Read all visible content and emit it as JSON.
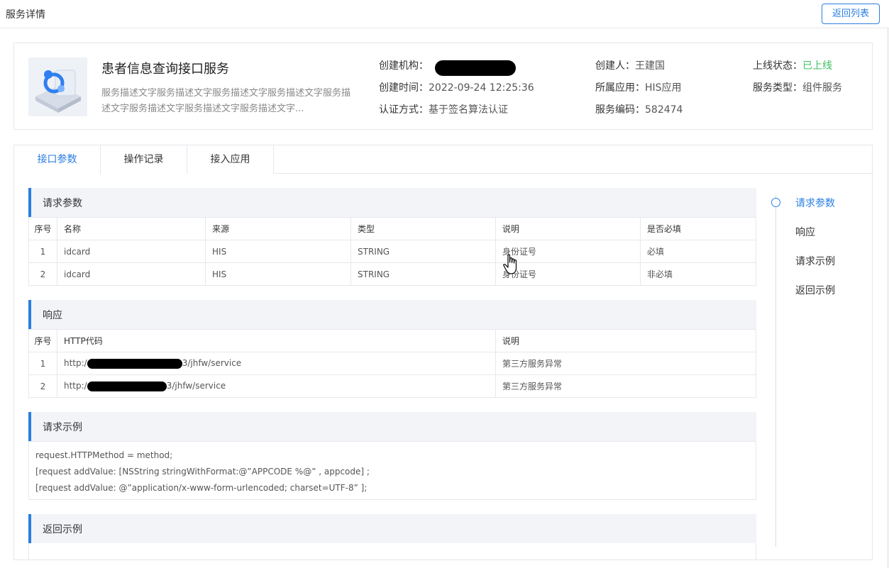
{
  "header": {
    "title": "服务详情",
    "back_label": "返回列表"
  },
  "service": {
    "name": "患者信息查询接口服务",
    "description": "服务描述文字服务描述文字服务描述文字服务描述文字服务描述文字服务描述文字服务描述文字服务描述文字...",
    "org_label": "创建机构：",
    "created_time_label": "创建时间：",
    "created_time": "2022-09-24 12:25:36",
    "auth_label": "认证方式：",
    "auth": "基于签名算法认证",
    "creator_label": "创建人：",
    "creator": "王建国",
    "app_label": "所属应用：",
    "app": "HIS应用",
    "code_label": "服务编码：",
    "code": "582474",
    "status_label": "上线状态：",
    "status": "已上线",
    "type_label": "服务类型：",
    "type": "组件服务"
  },
  "tabs": [
    {
      "label": "接口参数",
      "active": true
    },
    {
      "label": "操作记录",
      "active": false
    },
    {
      "label": "接入应用",
      "active": false
    }
  ],
  "request_params": {
    "title": "请求参数",
    "columns": [
      "序号",
      "名称",
      "来源",
      "类型",
      "说明",
      "是否必填"
    ],
    "rows": [
      [
        "1",
        "idcard",
        "HIS",
        "STRING",
        "身份证号",
        "必填"
      ],
      [
        "2",
        "idcard",
        "HIS",
        "STRING",
        "身份证号",
        "非必填"
      ]
    ]
  },
  "response": {
    "title": "响应",
    "columns": [
      "序号",
      "HTTP代码",
      "说明"
    ],
    "rows": [
      [
        "1",
        "http:/",
        "3/jhfw/service",
        "第三方服务异常"
      ],
      [
        "2",
        "http:/",
        "3/jhfw/service",
        "第三方服务异常"
      ]
    ]
  },
  "request_example": {
    "title": "请求示例",
    "lines": [
      "request.HTTPMethod  =  method;",
      "[request addValue: [NSString  stringWithFormat:@”APPCODE %@” ,  appcode] ;",
      "[request addValue: @”application/x-www-form-urlencoded; charset=UTF-8” ];"
    ]
  },
  "response_example": {
    "title": "返回示例"
  },
  "anchors": [
    {
      "label": "请求参数",
      "active": true
    },
    {
      "label": "响应",
      "active": false
    },
    {
      "label": "请求示例",
      "active": false
    },
    {
      "label": "返回示例",
      "active": false
    }
  ],
  "colors": {
    "accent": "#2a7ee0",
    "online": "#3bbf60",
    "section_bg": "#f2f4f8"
  },
  "icons": [
    "service-logo-icon",
    "hand-cursor-icon"
  ]
}
